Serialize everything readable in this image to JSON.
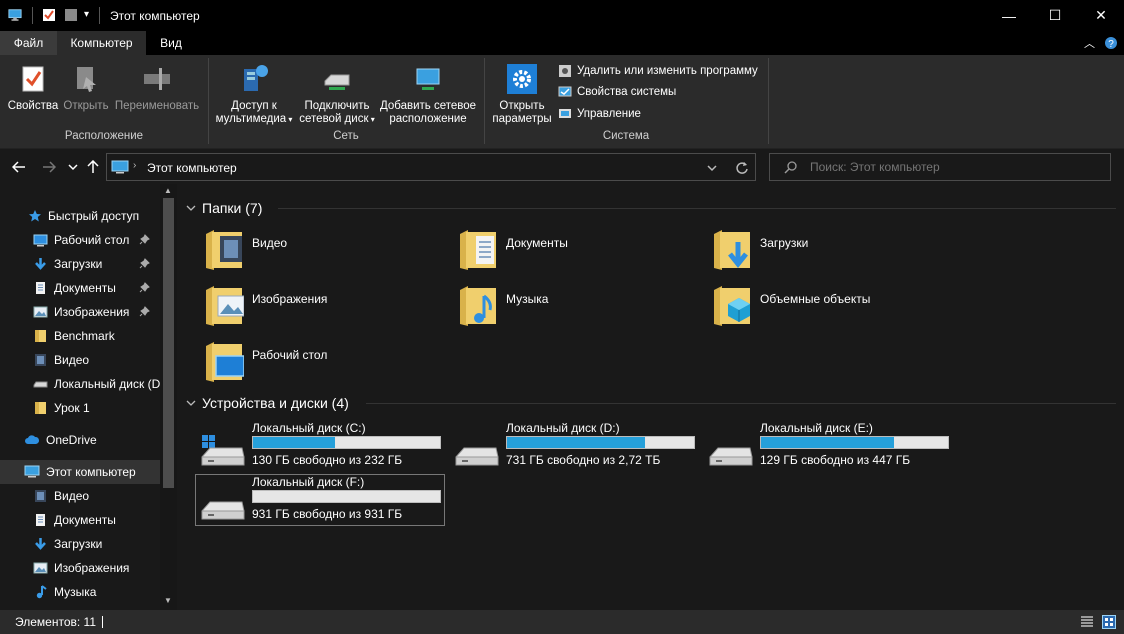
{
  "window": {
    "title": "Этот компьютер",
    "minimize_glyph": "—",
    "maximize_glyph": "☐",
    "close_glyph": "✕"
  },
  "menu_tabs": [
    "Файл",
    "Компьютер",
    "Вид"
  ],
  "ribbon": {
    "location": {
      "label": "Расположение",
      "properties": "Свойства",
      "open": "Открыть",
      "rename": "Переименовать"
    },
    "network": {
      "label": "Сеть",
      "media_line1": "Доступ к",
      "media_line2": "мультимедиа",
      "map_line1": "Подключить",
      "map_line2": "сетевой диск",
      "add_line1": "Добавить сетевое",
      "add_line2": "расположение"
    },
    "system": {
      "label": "Система",
      "settings_line1": "Открыть",
      "settings_line2": "параметры",
      "uninstall": "Удалить или изменить программу",
      "system_props": "Свойства системы",
      "manage": "Управление"
    }
  },
  "address": {
    "path": "Этот компьютер",
    "search_placeholder": "Поиск: Этот компьютер"
  },
  "sidebar": {
    "quick_access": "Быстрый доступ",
    "quick_items": [
      {
        "label": "Рабочий стол",
        "pinned": true,
        "icon": "desktop-icon"
      },
      {
        "label": "Загрузки",
        "pinned": true,
        "icon": "download-icon"
      },
      {
        "label": "Документы",
        "pinned": true,
        "icon": "document-icon"
      },
      {
        "label": "Изображения",
        "pinned": true,
        "icon": "image-icon"
      },
      {
        "label": "Benchmark",
        "pinned": false,
        "icon": "folder-icon"
      },
      {
        "label": "Видео",
        "pinned": false,
        "icon": "video-icon"
      },
      {
        "label": "Локальный диск (D",
        "pinned": false,
        "icon": "drive-icon"
      },
      {
        "label": "Урок 1",
        "pinned": false,
        "icon": "folder-icon"
      }
    ],
    "onedrive": "OneDrive",
    "this_pc": "Этот компьютер",
    "pc_items": [
      {
        "label": "Видео",
        "icon": "video-icon"
      },
      {
        "label": "Документы",
        "icon": "document-icon"
      },
      {
        "label": "Загрузки",
        "icon": "download-icon"
      },
      {
        "label": "Изображения",
        "icon": "image-icon"
      },
      {
        "label": "Музыка",
        "icon": "music-icon"
      }
    ]
  },
  "folders_section": {
    "title": "Папки (7)",
    "items": [
      {
        "name": "Видео",
        "overlay": "video"
      },
      {
        "name": "Документы",
        "overlay": "document"
      },
      {
        "name": "Загрузки",
        "overlay": "download"
      },
      {
        "name": "Изображения",
        "overlay": "image"
      },
      {
        "name": "Музыка",
        "overlay": "music"
      },
      {
        "name": "Объемные объекты",
        "overlay": "3d"
      },
      {
        "name": "Рабочий стол",
        "overlay": "desktop"
      }
    ]
  },
  "drives_section": {
    "title": "Устройства и диски (4)",
    "items": [
      {
        "name": "Локальный диск (C:)",
        "free": "130 ГБ свободно из 232 ГБ",
        "used_fraction": 0.44,
        "windows_logo": true
      },
      {
        "name": "Локальный диск (D:)",
        "free": "731 ГБ свободно из 2,72 ТБ",
        "used_fraction": 0.74,
        "windows_logo": false
      },
      {
        "name": "Локальный диск (E:)",
        "free": "129 ГБ свободно из 447 ГБ",
        "used_fraction": 0.71,
        "windows_logo": false
      },
      {
        "name": "Локальный диск (F:)",
        "free": "931 ГБ свободно из 931 ГБ",
        "used_fraction": 0.0,
        "windows_logo": false
      }
    ]
  },
  "status": {
    "items_count": "Элементов: 11"
  },
  "colors": {
    "accent": "#26a0da",
    "folder": "#e8c35c",
    "background": "#191919",
    "ribbon": "#2b2b2b"
  }
}
